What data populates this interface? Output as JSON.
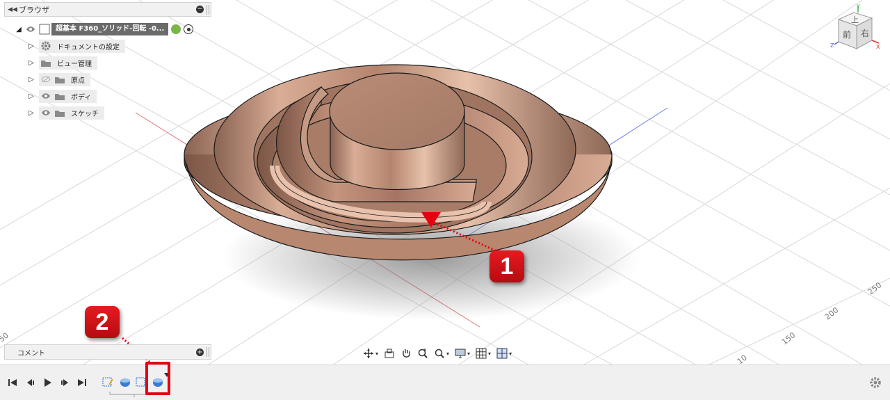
{
  "browser": {
    "title": "ブラウザ",
    "root": {
      "label": "超基本 F360_ソリッド-回転 -0..."
    },
    "items": [
      {
        "label": "ドキュメントの設定",
        "icon": "gear-icon",
        "eye": "none"
      },
      {
        "label": "ビュー管理",
        "icon": "folder-icon",
        "eye": "none"
      },
      {
        "label": "原点",
        "icon": "folder-icon",
        "eye": "hidden-eye-icon"
      },
      {
        "label": "ボディ",
        "icon": "folder-icon",
        "eye": "eye-icon"
      },
      {
        "label": "スケッチ",
        "icon": "folder-icon",
        "eye": "eye-icon"
      }
    ]
  },
  "comments": {
    "title": "コメント"
  },
  "viewcube": {
    "top": "上",
    "front": "前",
    "right": "右",
    "axis_x": "X",
    "axis_y": "Y",
    "axis_z": "Z"
  },
  "grid": {
    "labels": [
      "250",
      "200",
      "150",
      "10",
      "50"
    ]
  },
  "callouts": {
    "one": "1",
    "two": "2"
  },
  "colors": {
    "accent": "#e3000f",
    "body": "#c89a84",
    "grid_red": "#e05050",
    "grid_blue": "#5060e0"
  }
}
